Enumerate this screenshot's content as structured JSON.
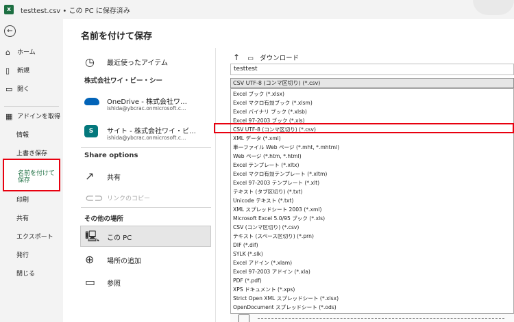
{
  "titlebar": {
    "text": "testtest.csv • この PC に保存済み",
    "app_icon": "excel-icon"
  },
  "sidebar": {
    "back_icon": "back-arrow-icon",
    "home": "ホーム",
    "new": "新規",
    "open": "開く",
    "get_addins": "アドインを取得",
    "info": "情報",
    "save": "上書き保存",
    "save_as": "名前を付けて保存",
    "print": "印刷",
    "share": "共有",
    "export": "エクスポート",
    "publish": "発行",
    "close": "閉じる"
  },
  "page_title": "名前を付けて保存",
  "locations": {
    "recent": "最近使ったアイテム",
    "org_heading": "株式会社ワイ・ビー・シー",
    "onedrive_title": "OneDrive - 株式会社ワ…",
    "onedrive_email": "ishida@ybcrac.onmicrosoft.c…",
    "site_title": "サイト - 株式会社ワイ・ビ…",
    "site_email": "ishida@ybcrac.onmicrosoft.c…",
    "share_heading": "Share options",
    "share": "共有",
    "link_copy": "リンクのコピー",
    "other_heading": "その他の場所",
    "this_pc": "この PC",
    "add_place": "場所の追加",
    "browse": "参照"
  },
  "breadcrumb": {
    "folder": "ダウンロード"
  },
  "filename": "testtest",
  "filetype_selected": "CSV UTF-8 (コンマ区切り) (*.csv)",
  "filetype_options": [
    "Excel ブック (*.xlsx)",
    "Excel マクロ有効ブック (*.xlsm)",
    "Excel バイナリ ブック (*.xlsb)",
    "Excel 97-2003 ブック (*.xls)",
    "CSV UTF-8 (コンマ区切り) (*.csv)",
    "XML データ (*.xml)",
    "単一ファイル Web ページ (*.mht, *.mhtml)",
    "Web ページ (*.htm, *.html)",
    "Excel テンプレート (*.xltx)",
    "Excel マクロ有効テンプレート (*.xltm)",
    "Excel 97-2003 テンプレート (*.xlt)",
    "テキスト (タブ区切り) (*.txt)",
    "Unicode テキスト (*.txt)",
    "XML スプレッドシート 2003 (*.xml)",
    "Microsoft Excel 5.0/95 ブック (*.xls)",
    "CSV (コンマ区切り) (*.csv)",
    "テキスト (スペース区切り) (*.prn)",
    "DIF (*.dif)",
    "SYLK (*.slk)",
    "Excel アドイン (*.xlam)",
    "Excel 97-2003 アドイン (*.xla)",
    "PDF (*.pdf)",
    "XPS ドキュメント (*.xps)",
    "Strict Open XML スプレッドシート (*.xlsx)",
    "OpenDocument スプレッドシート (*.ods)"
  ],
  "colors": {
    "excel_green": "#1d6f42",
    "highlight_red": "#e8000f",
    "onedrive_blue": "#0364b8",
    "site_teal": "#03787c"
  }
}
